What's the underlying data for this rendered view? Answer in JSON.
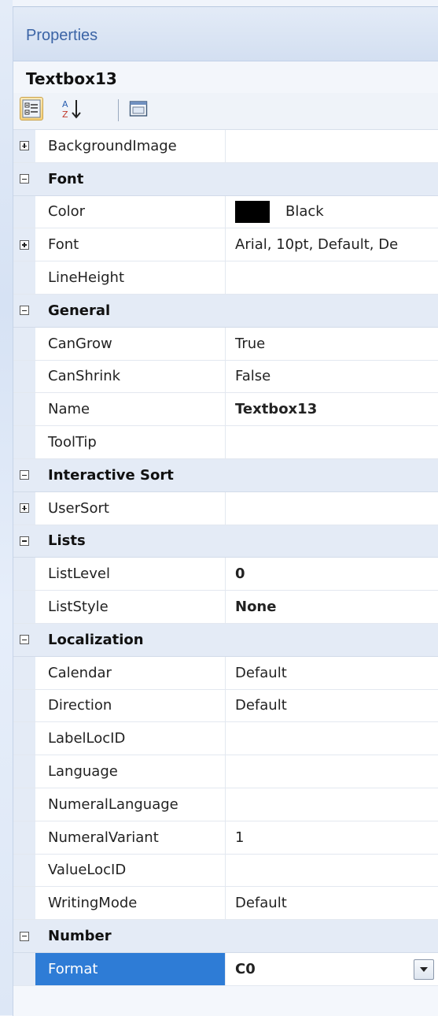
{
  "panel": {
    "title": "Properties",
    "object_name": "Textbox13"
  },
  "toolbar": {
    "buttons": [
      {
        "icon": "categorized-icon",
        "active": true
      },
      {
        "icon": "sort-alphabetical-icon",
        "active": false
      },
      {
        "icon": "property-pages-icon",
        "active": false
      }
    ]
  },
  "rows": [
    {
      "kind": "prop",
      "toggle": "plus",
      "name": "BackgroundImage",
      "value": ""
    },
    {
      "kind": "category",
      "toggle": "minus",
      "name": "Font"
    },
    {
      "kind": "prop",
      "name": "Color",
      "value": "Black",
      "swatch": "#000000"
    },
    {
      "kind": "prop",
      "toggle": "plus",
      "name": "Font",
      "value": "Arial, 10pt, Default, De"
    },
    {
      "kind": "prop",
      "name": "LineHeight",
      "value": ""
    },
    {
      "kind": "category",
      "toggle": "minus",
      "name": "General"
    },
    {
      "kind": "prop",
      "name": "CanGrow",
      "value": "True"
    },
    {
      "kind": "prop",
      "name": "CanShrink",
      "value": "False"
    },
    {
      "kind": "prop",
      "name": "Name",
      "value": "Textbox13",
      "bold": true
    },
    {
      "kind": "prop",
      "name": "ToolTip",
      "value": ""
    },
    {
      "kind": "category",
      "toggle": "minus",
      "name": "Interactive Sort"
    },
    {
      "kind": "prop",
      "toggle": "plus",
      "name": "UserSort",
      "value": ""
    },
    {
      "kind": "category",
      "toggle": "minus",
      "name": "Lists"
    },
    {
      "kind": "prop",
      "name": "ListLevel",
      "value": "0",
      "bold": true
    },
    {
      "kind": "prop",
      "name": "ListStyle",
      "value": "None",
      "bold": true
    },
    {
      "kind": "category",
      "toggle": "minus",
      "name": "Localization"
    },
    {
      "kind": "prop",
      "name": "Calendar",
      "value": "Default"
    },
    {
      "kind": "prop",
      "name": "Direction",
      "value": "Default"
    },
    {
      "kind": "prop",
      "name": "LabelLocID",
      "value": ""
    },
    {
      "kind": "prop",
      "name": "Language",
      "value": ""
    },
    {
      "kind": "prop",
      "name": "NumeralLanguage",
      "value": ""
    },
    {
      "kind": "prop",
      "name": "NumeralVariant",
      "value": "1"
    },
    {
      "kind": "prop",
      "name": "ValueLocID",
      "value": ""
    },
    {
      "kind": "prop",
      "name": "WritingMode",
      "value": "Default"
    },
    {
      "kind": "category",
      "toggle": "minus",
      "name": "Number"
    },
    {
      "kind": "prop",
      "name": "Format",
      "value": "C0",
      "bold": true,
      "selected": true,
      "dropdown": true
    }
  ],
  "colors": {
    "selection": "#2e7cd6",
    "category_bg": "#e4ebf6",
    "title": "#3b64a6"
  }
}
